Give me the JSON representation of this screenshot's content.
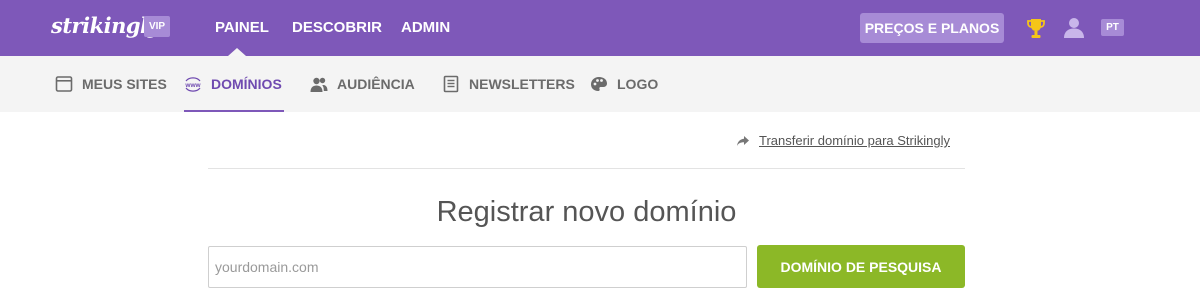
{
  "brand": {
    "logo": "strikingly",
    "vip_badge": "VIP"
  },
  "main_nav": {
    "items": [
      {
        "label": "PAINEL",
        "active": true
      },
      {
        "label": "DESCOBRIR",
        "active": false
      },
      {
        "label": "ADMIN",
        "active": false
      }
    ]
  },
  "header_actions": {
    "pricing_label": "PREÇOS E PLANOS",
    "trophy_icon": "trophy-icon",
    "user_icon": "user-icon",
    "language": "PT"
  },
  "sub_nav": {
    "items": [
      {
        "label": "MEUS SITES",
        "icon": "browser-window-icon",
        "active": false
      },
      {
        "label": "DOMÍNIOS",
        "icon": "www-icon",
        "active": true
      },
      {
        "label": "AUDIÊNCIA",
        "icon": "users-icon",
        "active": false
      },
      {
        "label": "NEWSLETTERS",
        "icon": "newsletter-icon",
        "active": false
      },
      {
        "label": "LOGO",
        "icon": "palette-icon",
        "active": false
      }
    ]
  },
  "content": {
    "transfer_link": "Transferir domínio para Strikingly",
    "heading": "Registrar novo domínio",
    "domain_placeholder": "yourdomain.com",
    "domain_value": "",
    "search_button": "DOMÍNIO DE PESQUISA"
  },
  "colors": {
    "topbar": "#7e58b9",
    "badge": "#a78bd6",
    "active_tab": "#6f4ab0",
    "search_button": "#8cb827",
    "trophy": "#f5c518"
  }
}
